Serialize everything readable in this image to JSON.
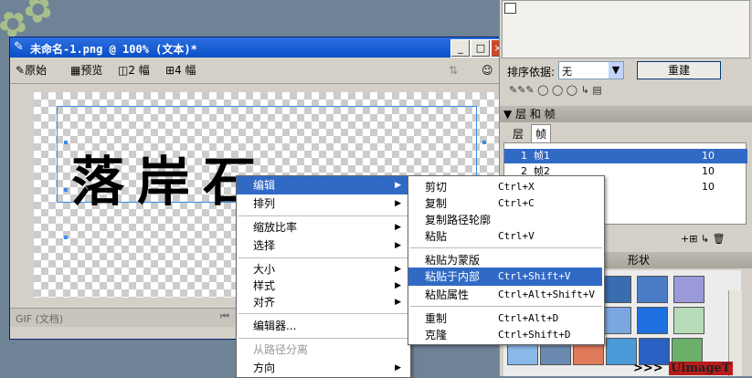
{
  "document": {
    "title": "未命名-1.png @ 100% (文本)*",
    "toolbar": {
      "original_label": "原始",
      "preview_label": "预览",
      "two_frame_label": "2 幅",
      "four_frame_label": "4 幅"
    },
    "canvas_text": "落岸石",
    "status_left": "GIF (文档)"
  },
  "right_panel": {
    "sort_label": "排序依据:",
    "sort_value": "无",
    "rebuild_button": "重建",
    "layers_frames_title": "层 和 帧",
    "tab_layers": "层",
    "tab_frames": "帧",
    "frames": [
      {
        "num": "1",
        "name": "帧1",
        "delay": "10"
      },
      {
        "num": "2",
        "name": "帧2",
        "delay": "10"
      },
      {
        "num": "3",
        "name": "",
        "delay": "10"
      }
    ],
    "shapes_title": "形状",
    "bottom_label": ">>>"
  },
  "context_menu": {
    "items": [
      {
        "label": "编辑",
        "submenu": true,
        "highlight": true
      },
      {
        "label": "排列",
        "submenu": true
      },
      {
        "label": "缩放比率",
        "submenu": true
      },
      {
        "label": "选择",
        "submenu": true
      },
      {
        "label": "大小",
        "submenu": true
      },
      {
        "label": "样式",
        "submenu": true
      },
      {
        "label": "对齐",
        "submenu": true
      },
      {
        "label": "编辑器..."
      },
      {
        "label": "从路径分离",
        "disabled": true
      },
      {
        "label": "方向",
        "submenu": true
      }
    ]
  },
  "submenu": {
    "items": [
      {
        "label": "剪切",
        "shortcut": "Ctrl+X"
      },
      {
        "label": "复制",
        "shortcut": "Ctrl+C"
      },
      {
        "label": "复制路径轮廓",
        "shortcut": ""
      },
      {
        "label": "粘贴",
        "shortcut": "Ctrl+V"
      },
      {
        "label": "粘贴为蒙版",
        "shortcut": ""
      },
      {
        "label": "粘贴于内部",
        "shortcut": "Ctrl+Shift+V",
        "highlight": true
      },
      {
        "label": "粘贴属性",
        "shortcut": "Ctrl+Alt+Shift+V"
      },
      {
        "label": "重制",
        "shortcut": "Ctrl+Alt+D"
      },
      {
        "label": "克隆",
        "shortcut": "Ctrl+Shift+D"
      }
    ]
  },
  "brand": "UimageT",
  "colors": {
    "title_bar": "#0a4fc8",
    "highlight": "#316ac5",
    "selection": "#3a8ce6"
  }
}
